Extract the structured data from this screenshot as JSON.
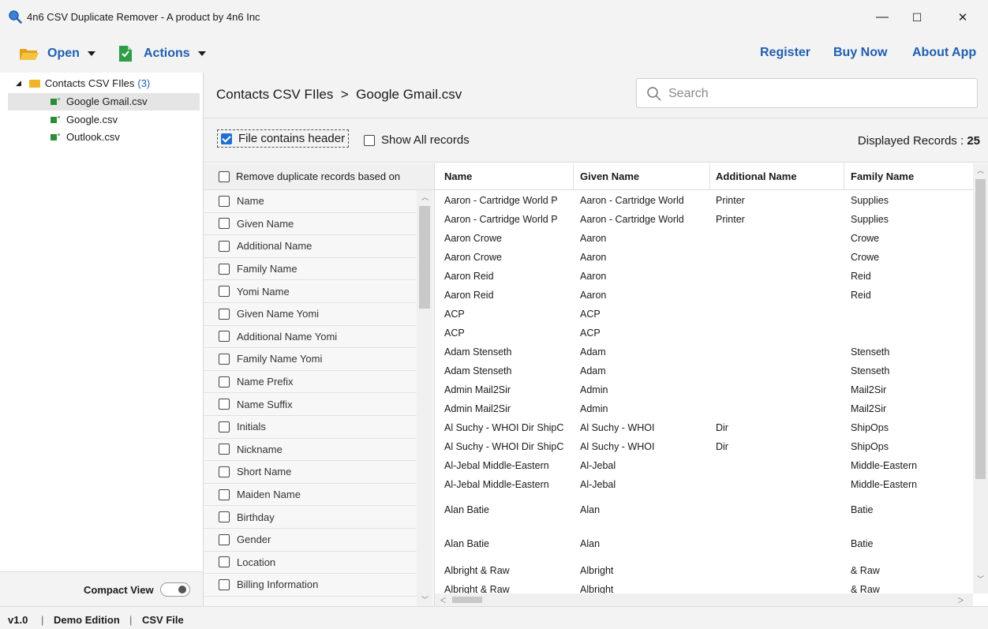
{
  "window": {
    "title": "4n6 CSV Duplicate Remover - A product by 4n6 Inc",
    "minimize": "—",
    "maximize": "☐",
    "close": "✕"
  },
  "toolbar": {
    "open_label": "Open",
    "actions_label": "Actions",
    "register_label": "Register",
    "buy_now_label": "Buy Now",
    "about_label": "About App"
  },
  "tree": {
    "root_label": "Contacts CSV FIles",
    "root_count": "(3)",
    "files": [
      "Google Gmail.csv",
      "Google.csv",
      "Outlook.csv"
    ],
    "selected_index": 0
  },
  "compact_view": {
    "label": "Compact View",
    "enabled": false
  },
  "status": {
    "version": "v1.0",
    "edition": "Demo Edition",
    "type": "CSV File",
    "separator": "|"
  },
  "breadcrumb": "Contacts CSV FIles  >  Google Gmail.csv",
  "search": {
    "placeholder": "Search",
    "value": ""
  },
  "options": {
    "file_contains_header": {
      "label": "File contains header",
      "checked": true
    },
    "show_all_records": {
      "label": "Show All records",
      "checked": false
    },
    "displayed_label": "Displayed Records :",
    "displayed_count": "25"
  },
  "fields": {
    "header": "Remove duplicate records based on",
    "items": [
      "Name",
      "Given Name",
      "Additional Name",
      "Family Name",
      "Yomi Name",
      "Given Name Yomi",
      "Additional Name Yomi",
      "Family Name Yomi",
      "Name Prefix",
      "Name Suffix",
      "Initials",
      "Nickname",
      "Short Name",
      "Maiden Name",
      "Birthday",
      "Gender",
      "Location",
      "Billing Information"
    ]
  },
  "records": {
    "columns": [
      "Name",
      "Given Name",
      "Additional Name",
      "Family Name"
    ],
    "rows": [
      [
        "Aaron - Cartridge World P",
        "Aaron - Cartridge World",
        "Printer",
        "Supplies"
      ],
      [
        "Aaron - Cartridge World P",
        "Aaron - Cartridge World",
        "Printer",
        "Supplies"
      ],
      [
        "Aaron Crowe",
        "Aaron",
        "",
        "Crowe"
      ],
      [
        "Aaron Crowe",
        "Aaron",
        "",
        "Crowe"
      ],
      [
        "Aaron Reid",
        "Aaron",
        "",
        "Reid"
      ],
      [
        "Aaron Reid",
        "Aaron",
        "",
        "Reid"
      ],
      [
        "ACP",
        "ACP",
        "",
        ""
      ],
      [
        "ACP",
        "ACP",
        "",
        ""
      ],
      [
        "Adam Stenseth",
        "Adam",
        "",
        "Stenseth"
      ],
      [
        "Adam Stenseth",
        "Adam",
        "",
        "Stenseth"
      ],
      [
        "Admin Mail2Sir",
        "Admin",
        "",
        "Mail2Sir"
      ],
      [
        "Admin Mail2Sir",
        "Admin",
        "",
        "Mail2Sir"
      ],
      [
        "Al Suchy - WHOI Dir ShipC",
        "Al Suchy - WHOI",
        "Dir",
        "ShipOps"
      ],
      [
        "Al Suchy - WHOI Dir ShipC",
        "Al Suchy - WHOI",
        "Dir",
        "ShipOps"
      ],
      [
        "Al-Jebal Middle-Eastern",
        "Al-Jebal",
        "",
        "Middle-Eastern"
      ],
      [
        "Al-Jebal Middle-Eastern",
        "Al-Jebal",
        "",
        "Middle-Eastern"
      ],
      [
        "Alan Batie",
        "Alan",
        "",
        "Batie"
      ],
      [
        "Alan Batie",
        "Alan",
        "",
        "Batie"
      ],
      [
        "Albright & Raw",
        "Albright",
        "",
        "& Raw"
      ],
      [
        "Albright & Raw",
        "Albright",
        "",
        "& Raw"
      ]
    ]
  },
  "colors": {
    "accent": "#1f5fb0",
    "check": "#1f6fd0",
    "folder": "#f0b429",
    "file": "#2e8b3a"
  }
}
